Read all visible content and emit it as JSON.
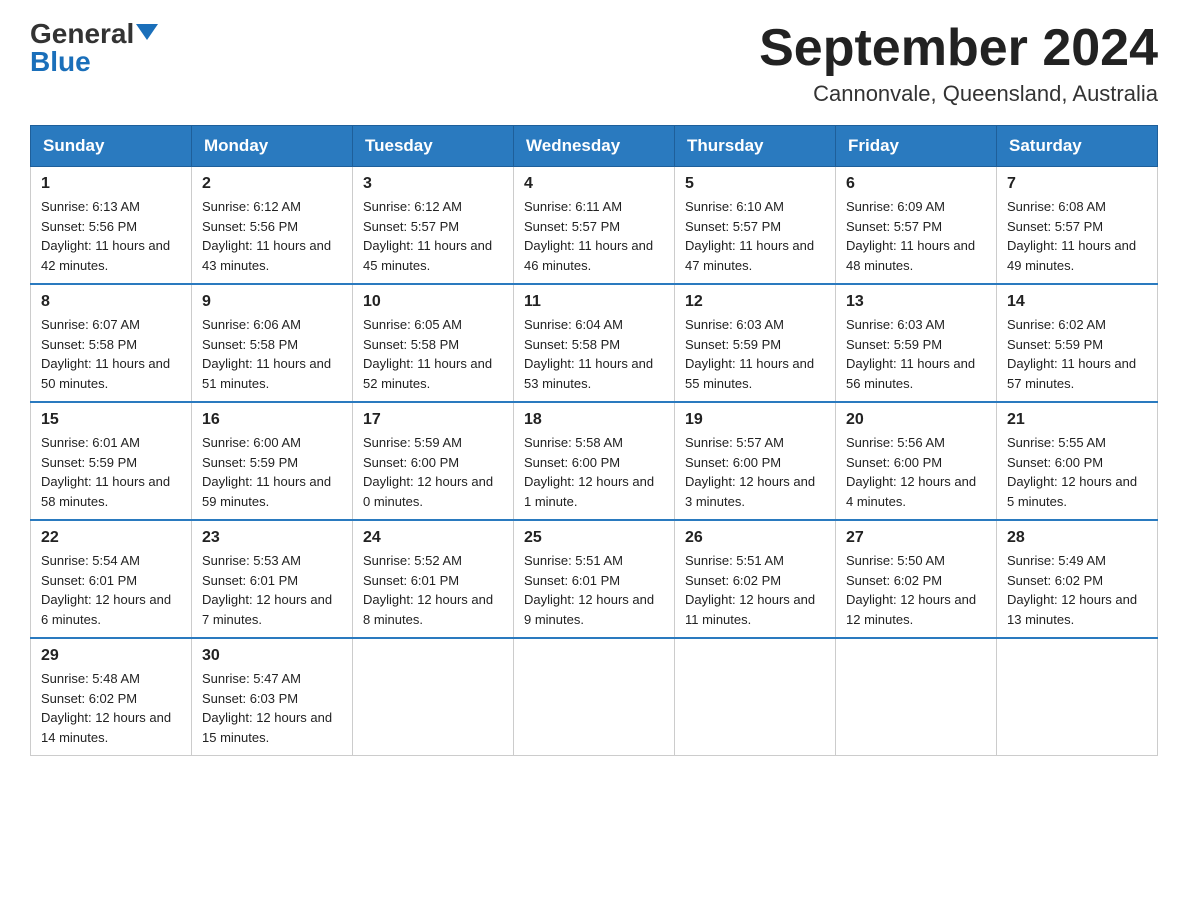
{
  "header": {
    "logo_general": "General",
    "logo_blue": "Blue",
    "month_title": "September 2024",
    "location": "Cannonvale, Queensland, Australia"
  },
  "days_of_week": [
    "Sunday",
    "Monday",
    "Tuesday",
    "Wednesday",
    "Thursday",
    "Friday",
    "Saturday"
  ],
  "weeks": [
    [
      {
        "day": "1",
        "sunrise": "6:13 AM",
        "sunset": "5:56 PM",
        "daylight": "11 hours and 42 minutes."
      },
      {
        "day": "2",
        "sunrise": "6:12 AM",
        "sunset": "5:56 PM",
        "daylight": "11 hours and 43 minutes."
      },
      {
        "day": "3",
        "sunrise": "6:12 AM",
        "sunset": "5:57 PM",
        "daylight": "11 hours and 45 minutes."
      },
      {
        "day": "4",
        "sunrise": "6:11 AM",
        "sunset": "5:57 PM",
        "daylight": "11 hours and 46 minutes."
      },
      {
        "day": "5",
        "sunrise": "6:10 AM",
        "sunset": "5:57 PM",
        "daylight": "11 hours and 47 minutes."
      },
      {
        "day": "6",
        "sunrise": "6:09 AM",
        "sunset": "5:57 PM",
        "daylight": "11 hours and 48 minutes."
      },
      {
        "day": "7",
        "sunrise": "6:08 AM",
        "sunset": "5:57 PM",
        "daylight": "11 hours and 49 minutes."
      }
    ],
    [
      {
        "day": "8",
        "sunrise": "6:07 AM",
        "sunset": "5:58 PM",
        "daylight": "11 hours and 50 minutes."
      },
      {
        "day": "9",
        "sunrise": "6:06 AM",
        "sunset": "5:58 PM",
        "daylight": "11 hours and 51 minutes."
      },
      {
        "day": "10",
        "sunrise": "6:05 AM",
        "sunset": "5:58 PM",
        "daylight": "11 hours and 52 minutes."
      },
      {
        "day": "11",
        "sunrise": "6:04 AM",
        "sunset": "5:58 PM",
        "daylight": "11 hours and 53 minutes."
      },
      {
        "day": "12",
        "sunrise": "6:03 AM",
        "sunset": "5:59 PM",
        "daylight": "11 hours and 55 minutes."
      },
      {
        "day": "13",
        "sunrise": "6:03 AM",
        "sunset": "5:59 PM",
        "daylight": "11 hours and 56 minutes."
      },
      {
        "day": "14",
        "sunrise": "6:02 AM",
        "sunset": "5:59 PM",
        "daylight": "11 hours and 57 minutes."
      }
    ],
    [
      {
        "day": "15",
        "sunrise": "6:01 AM",
        "sunset": "5:59 PM",
        "daylight": "11 hours and 58 minutes."
      },
      {
        "day": "16",
        "sunrise": "6:00 AM",
        "sunset": "5:59 PM",
        "daylight": "11 hours and 59 minutes."
      },
      {
        "day": "17",
        "sunrise": "5:59 AM",
        "sunset": "6:00 PM",
        "daylight": "12 hours and 0 minutes."
      },
      {
        "day": "18",
        "sunrise": "5:58 AM",
        "sunset": "6:00 PM",
        "daylight": "12 hours and 1 minute."
      },
      {
        "day": "19",
        "sunrise": "5:57 AM",
        "sunset": "6:00 PM",
        "daylight": "12 hours and 3 minutes."
      },
      {
        "day": "20",
        "sunrise": "5:56 AM",
        "sunset": "6:00 PM",
        "daylight": "12 hours and 4 minutes."
      },
      {
        "day": "21",
        "sunrise": "5:55 AM",
        "sunset": "6:00 PM",
        "daylight": "12 hours and 5 minutes."
      }
    ],
    [
      {
        "day": "22",
        "sunrise": "5:54 AM",
        "sunset": "6:01 PM",
        "daylight": "12 hours and 6 minutes."
      },
      {
        "day": "23",
        "sunrise": "5:53 AM",
        "sunset": "6:01 PM",
        "daylight": "12 hours and 7 minutes."
      },
      {
        "day": "24",
        "sunrise": "5:52 AM",
        "sunset": "6:01 PM",
        "daylight": "12 hours and 8 minutes."
      },
      {
        "day": "25",
        "sunrise": "5:51 AM",
        "sunset": "6:01 PM",
        "daylight": "12 hours and 9 minutes."
      },
      {
        "day": "26",
        "sunrise": "5:51 AM",
        "sunset": "6:02 PM",
        "daylight": "12 hours and 11 minutes."
      },
      {
        "day": "27",
        "sunrise": "5:50 AM",
        "sunset": "6:02 PM",
        "daylight": "12 hours and 12 minutes."
      },
      {
        "day": "28",
        "sunrise": "5:49 AM",
        "sunset": "6:02 PM",
        "daylight": "12 hours and 13 minutes."
      }
    ],
    [
      {
        "day": "29",
        "sunrise": "5:48 AM",
        "sunset": "6:02 PM",
        "daylight": "12 hours and 14 minutes."
      },
      {
        "day": "30",
        "sunrise": "5:47 AM",
        "sunset": "6:03 PM",
        "daylight": "12 hours and 15 minutes."
      },
      null,
      null,
      null,
      null,
      null
    ]
  ]
}
